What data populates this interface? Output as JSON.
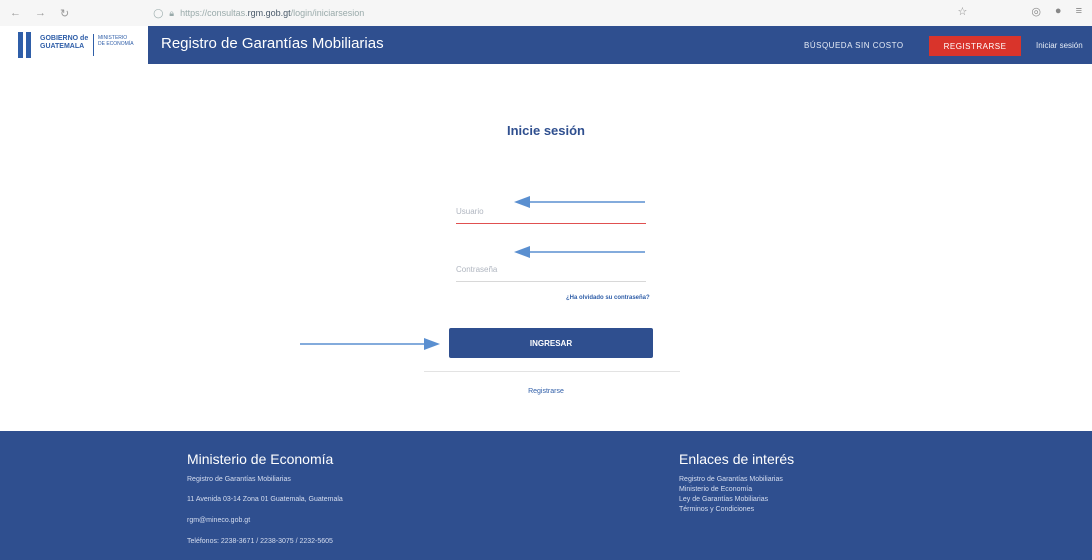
{
  "browser": {
    "url_prefix": "https://consultas.",
    "url_domain": "rgm.gob.gt",
    "url_path": "/login/iniciarsesion"
  },
  "header": {
    "logo_line1": "GOBIERNO de",
    "logo_line2": "GUATEMALA",
    "logo_ministry1": "MINISTERIO",
    "logo_ministry2": "DE ECONOMÍA",
    "title": "Registro de Garantías Mobiliarias",
    "busqueda": "BÚSQUEDA SIN COSTO",
    "registrarse": "REGISTRARSE",
    "iniciar": "Iniciar sesión"
  },
  "login": {
    "title": "Inicie sesión",
    "user_placeholder": "Usuario",
    "password_placeholder": "Contraseña",
    "forgot": "¿Ha olvidado su contraseña?",
    "submit": "INGRESAR",
    "register_link": "Registrarse"
  },
  "footer": {
    "left_title": "Ministerio de Economía",
    "left_lines": [
      "Registro de Garantías Mobiliarias",
      "11 Avenida 03-14 Zona 01 Guatemala, Guatemala",
      "rgm@mineco.gob.gt",
      "Teléfonos: 2238-3671 / 2238-3075 / 2232-5605"
    ],
    "right_title": "Enlaces de interés",
    "right_links": [
      "Registro de Garantías Mobiliarias",
      "Ministerio de Economía",
      "Ley de Garantías Mobiliarias",
      "Términos y Condiciones"
    ]
  },
  "colors": {
    "primary": "#2f4f8f",
    "accent_red": "#d9342b",
    "arrow": "#5a8fd0"
  }
}
